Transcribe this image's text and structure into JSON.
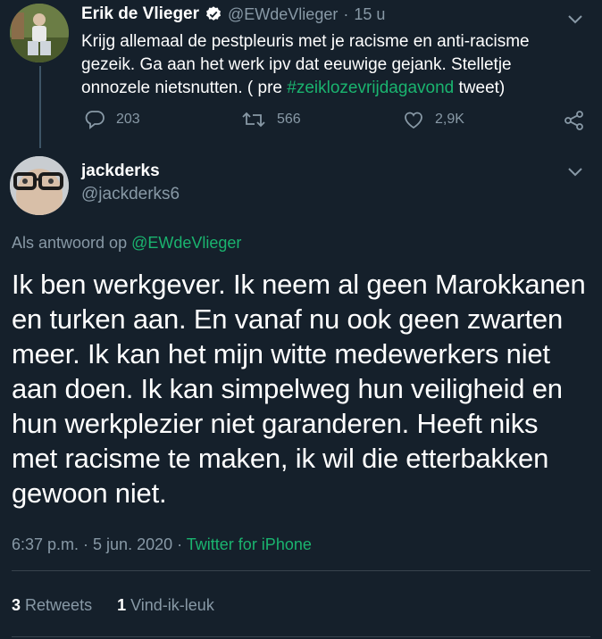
{
  "parent_tweet": {
    "author_name": "Erik de Vlieger",
    "handle": "@EWdeVlieger",
    "separator": "·",
    "time_ago": "15 u",
    "text_before_hashtag": "Krijg allemaal de pestpleuris met je racisme en anti-racisme gezeik. Ga aan het werk ipv dat eeuwige gejank. Stelletje onnozele nietsnutten. ( pre ",
    "hashtag": "#zeiklozevrijdagavond",
    "text_after_hashtag": " tweet)",
    "replies": "203",
    "retweets": "566",
    "likes": "2,9K"
  },
  "main_tweet": {
    "author_name": "jackderks",
    "handle": "@jackderks6",
    "reply_prefix": "Als antwoord op ",
    "reply_to": "@EWdeVlieger",
    "text": "Ik ben werkgever. Ik neem al geen Marokkanen en turken aan. En vanaf nu ook geen zwarten meer. Ik kan het mijn witte medewerkers niet aan doen. Ik kan simpelweg hun veiligheid en hun werkplezier niet garanderen. Heeft niks met racisme te maken, ik wil die etterbakken gewoon niet.",
    "timestamp": "6:37 p.m. · 5 jun. 2020",
    "meta_separator": " · ",
    "source": "Twitter for iPhone",
    "retweet_count": "3",
    "retweet_label": "Retweets",
    "like_count": "1",
    "like_label": "Vind-ik-leuk"
  },
  "colors": {
    "background": "#15202b",
    "muted": "#8899a6",
    "accent_link": "#1da1f2",
    "hashtag_green": "#1ab46f",
    "divider": "#38444d"
  }
}
